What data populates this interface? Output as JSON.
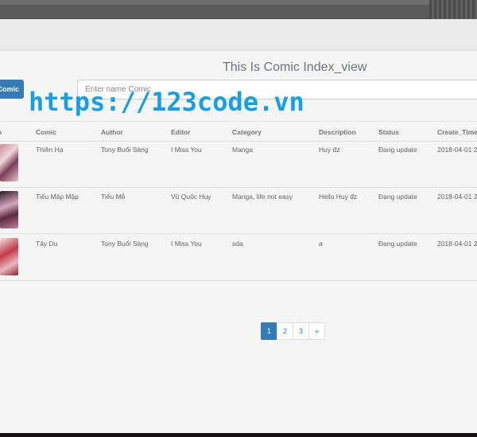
{
  "page": {
    "title": "This Is Comic Index_view"
  },
  "toolbar": {
    "add_label": "Comic",
    "search_placeholder": "Enter name Comic"
  },
  "table": {
    "headers": [
      "o",
      "Comic",
      "Author",
      "Editor",
      "Category",
      "Description",
      "Status",
      "Create_Time"
    ],
    "rows": [
      {
        "comic": "Thiên Hạ",
        "author": "Tony Buổi Sáng",
        "editor": "I Miss You",
        "category": "Manga",
        "description": "Huy đz",
        "status": "Đang update",
        "create_time": "2018-04-01 2"
      },
      {
        "comic": "Tiểu Mập Mập",
        "author": "Tiểu Mễ",
        "editor": "Vũ Quốc Huy",
        "category": "Manga, life not easy",
        "description": "Hello Huy đz",
        "status": "Đang update",
        "create_time": "2018-04-01 2"
      },
      {
        "comic": "Tây Du",
        "author": "Tony Buổi Sáng",
        "editor": "I Miss You",
        "category": "sda",
        "description": "a",
        "status": "Đang update",
        "create_time": "2018-04-01 2"
      }
    ]
  },
  "pagination": {
    "pages": [
      "1",
      "2",
      "3"
    ],
    "next": "»",
    "active": "1"
  },
  "watermark": "https://123code.vn",
  "colors": {
    "primary": "#337ab7",
    "watermark": "#14a0e6"
  }
}
